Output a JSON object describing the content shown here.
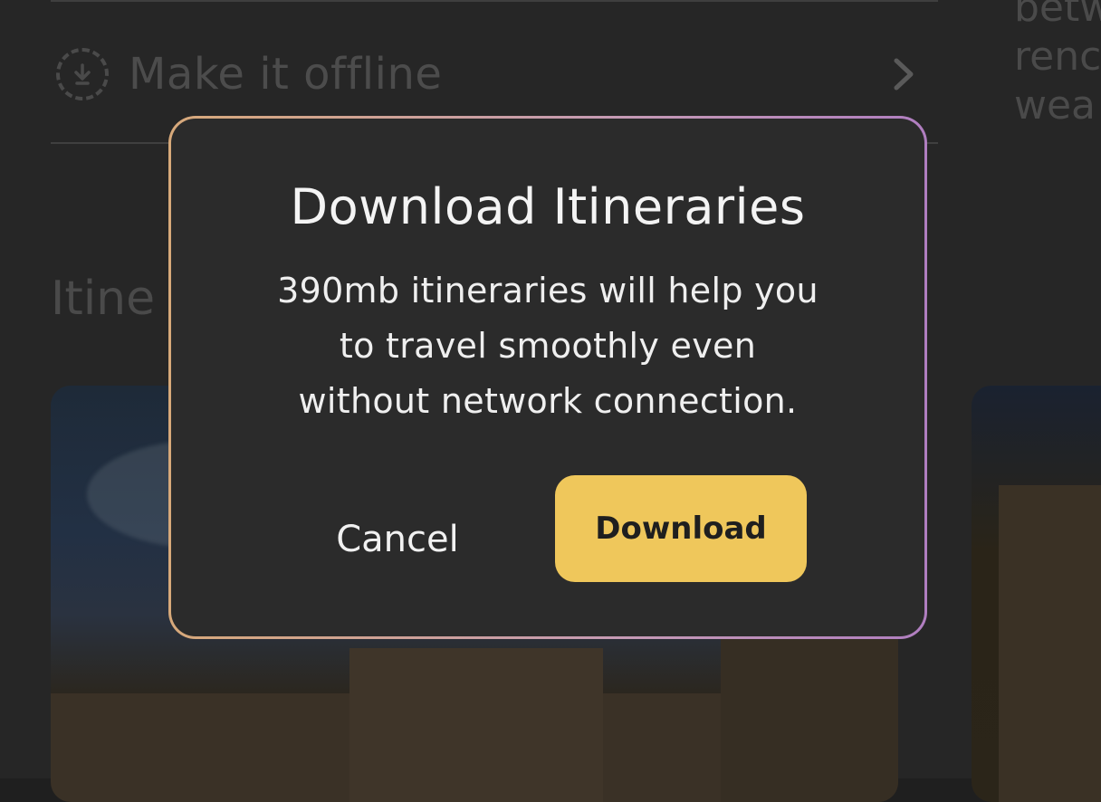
{
  "background": {
    "offline_row": {
      "label": "Make it offline",
      "icon": "download-circle-icon",
      "chevron_icon": "chevron-right-icon"
    },
    "section_heading_partial": "Itine",
    "right_partial_lines": [
      "betw",
      "renc",
      "wea"
    ]
  },
  "dialog": {
    "title": "Download Itineraries",
    "body_lines": [
      "390mb itineraries will help you",
      "to travel smoothly even",
      "without network connection."
    ],
    "cancel_label": "Cancel",
    "download_label": "Download"
  },
  "colors": {
    "accent": "#efc75b",
    "dialog_bg": "#2b2b2b",
    "border_gradient_start": "#d7a97a",
    "border_gradient_end": "#b07ec0"
  }
}
